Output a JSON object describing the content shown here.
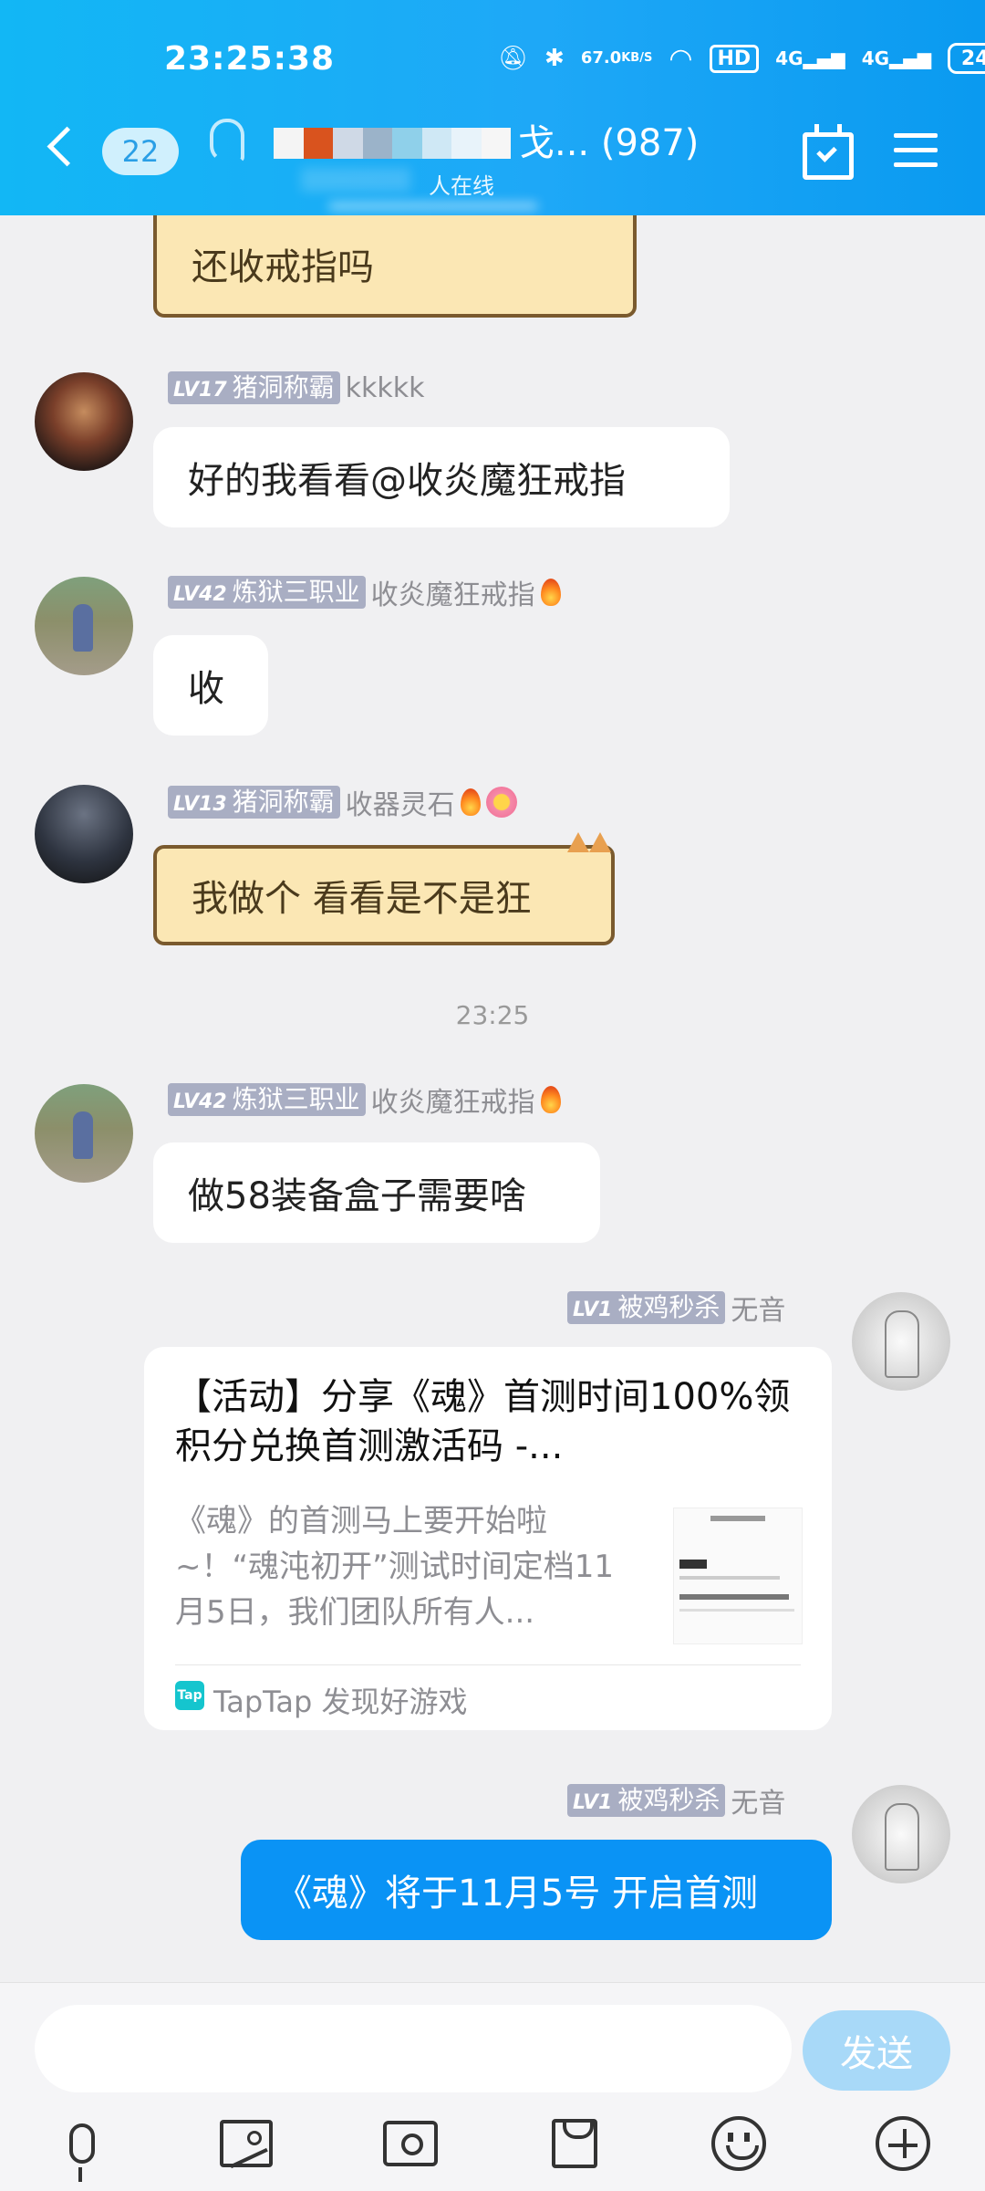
{
  "status_bar": {
    "time": "23:25:38",
    "net_speed_value": "67.0",
    "net_speed_unit": "KB/S",
    "hd_label": "HD",
    "signal1_label": "4G",
    "signal2_label": "4G",
    "battery": "24"
  },
  "header": {
    "unread_count": "22",
    "group_title_suffix": "戈... (987)",
    "online_label": "人在线",
    "blur_colors": [
      "#f4f4f4",
      "#d9531e",
      "#cfd9e6",
      "#9bb3c9",
      "#8fd0ea",
      "#cfe8f5",
      "#e8f3fa",
      "#f6f6f6"
    ]
  },
  "messages": [
    {
      "text": "还收戒指吗"
    },
    {
      "level": "LV17",
      "name": "猪洞称霸",
      "title": "kkkkk",
      "text": "好的我看看@收炎魔狂戒指"
    },
    {
      "level": "LV42",
      "name": "炼狱三职业",
      "title": "收炎魔狂戒指",
      "text": "收"
    },
    {
      "level": "LV13",
      "name": "猪洞称霸",
      "title": "收器灵石",
      "text": "我做个  看看是不是狂"
    },
    {
      "level": "LV42",
      "name": "炼狱三职业",
      "title": "收炎魔狂戒指",
      "text": "做58装备盒子需要啥"
    },
    {
      "level": "LV1",
      "name": "被鸡秒杀",
      "title": "无音"
    },
    {
      "level": "LV1",
      "name": "被鸡秒杀",
      "title": "无音",
      "text": "《魂》将于11月5号 开启首测"
    }
  ],
  "timestamp": "23:25",
  "share_card": {
    "title": "【活动】分享《魂》首测时间100%领积分兑换首测激活码 -...",
    "description": "《魂》的首测马上要开始啦~！“魂沌初开”测试时间定档11月5日，我们团队所有人...",
    "source": "TapTap 发现好游戏",
    "source_icon_text": "Tap"
  },
  "input_bar": {
    "send_label": "发送",
    "placeholder": ""
  },
  "icons": [
    "back-icon",
    "ear-icon",
    "calendar-check-icon",
    "menu-icon",
    "fire-icon",
    "flower-icon",
    "mic-icon",
    "image-icon",
    "camera-icon",
    "red-packet-icon",
    "emoji-icon",
    "plus-icon"
  ]
}
